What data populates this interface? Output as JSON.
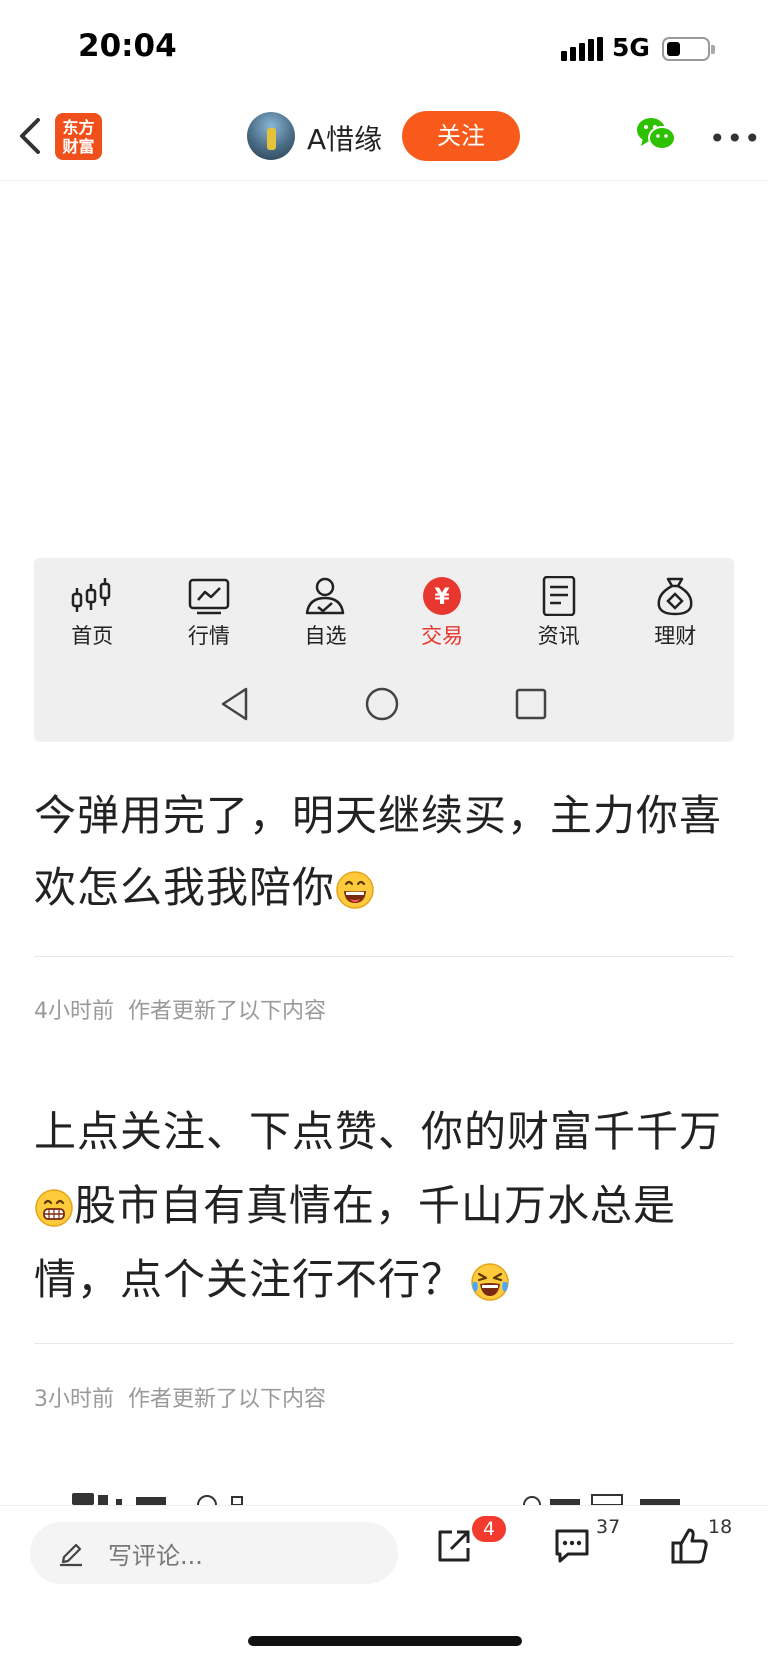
{
  "status_bar": {
    "time": "20:04",
    "network": "5G",
    "battery_icon": "battery-low-icon"
  },
  "nav": {
    "logo_line1": "东方",
    "logo_line2": "财富",
    "author_name": "A惜缘",
    "follow_label": "关注",
    "share_icon": "wechat-icon",
    "more_icon": "more-icon"
  },
  "embedded_screenshot": {
    "tabs": [
      {
        "label": "首页",
        "icon": "candlestick-icon"
      },
      {
        "label": "行情",
        "icon": "chart-icon"
      },
      {
        "label": "自选",
        "icon": "user-check-icon"
      },
      {
        "label": "交易",
        "icon": "yen-icon",
        "active": true
      },
      {
        "label": "资讯",
        "icon": "document-icon"
      },
      {
        "label": "理财",
        "icon": "money-bag-icon"
      }
    ],
    "active_color": "#e8372f"
  },
  "posts": [
    {
      "text": "今弹用完了，明天继续买，主力你喜欢怎么我我陪你",
      "emoji": "grinning-emoji"
    },
    {
      "meta_time": "4小时前",
      "meta_text": "作者更新了以下内容"
    },
    {
      "text_a": "上点关注、下点赞、你的财富千千万",
      "emoji_a": "grin-emoji",
      "text_b": "股市自有真情在，千山万水总是情，点个关注行不行？",
      "emoji_b": "laughing-tears-emoji"
    },
    {
      "meta_time": "3小时前",
      "meta_text": "作者更新了以下内容"
    }
  ],
  "bottom_bar": {
    "comment_placeholder": "写评论...",
    "share_count": "4",
    "comment_count": "37",
    "like_count": "18"
  },
  "colors": {
    "accent": "#f75a1a",
    "badge": "#f23a2f",
    "brand": "#f0501c"
  }
}
